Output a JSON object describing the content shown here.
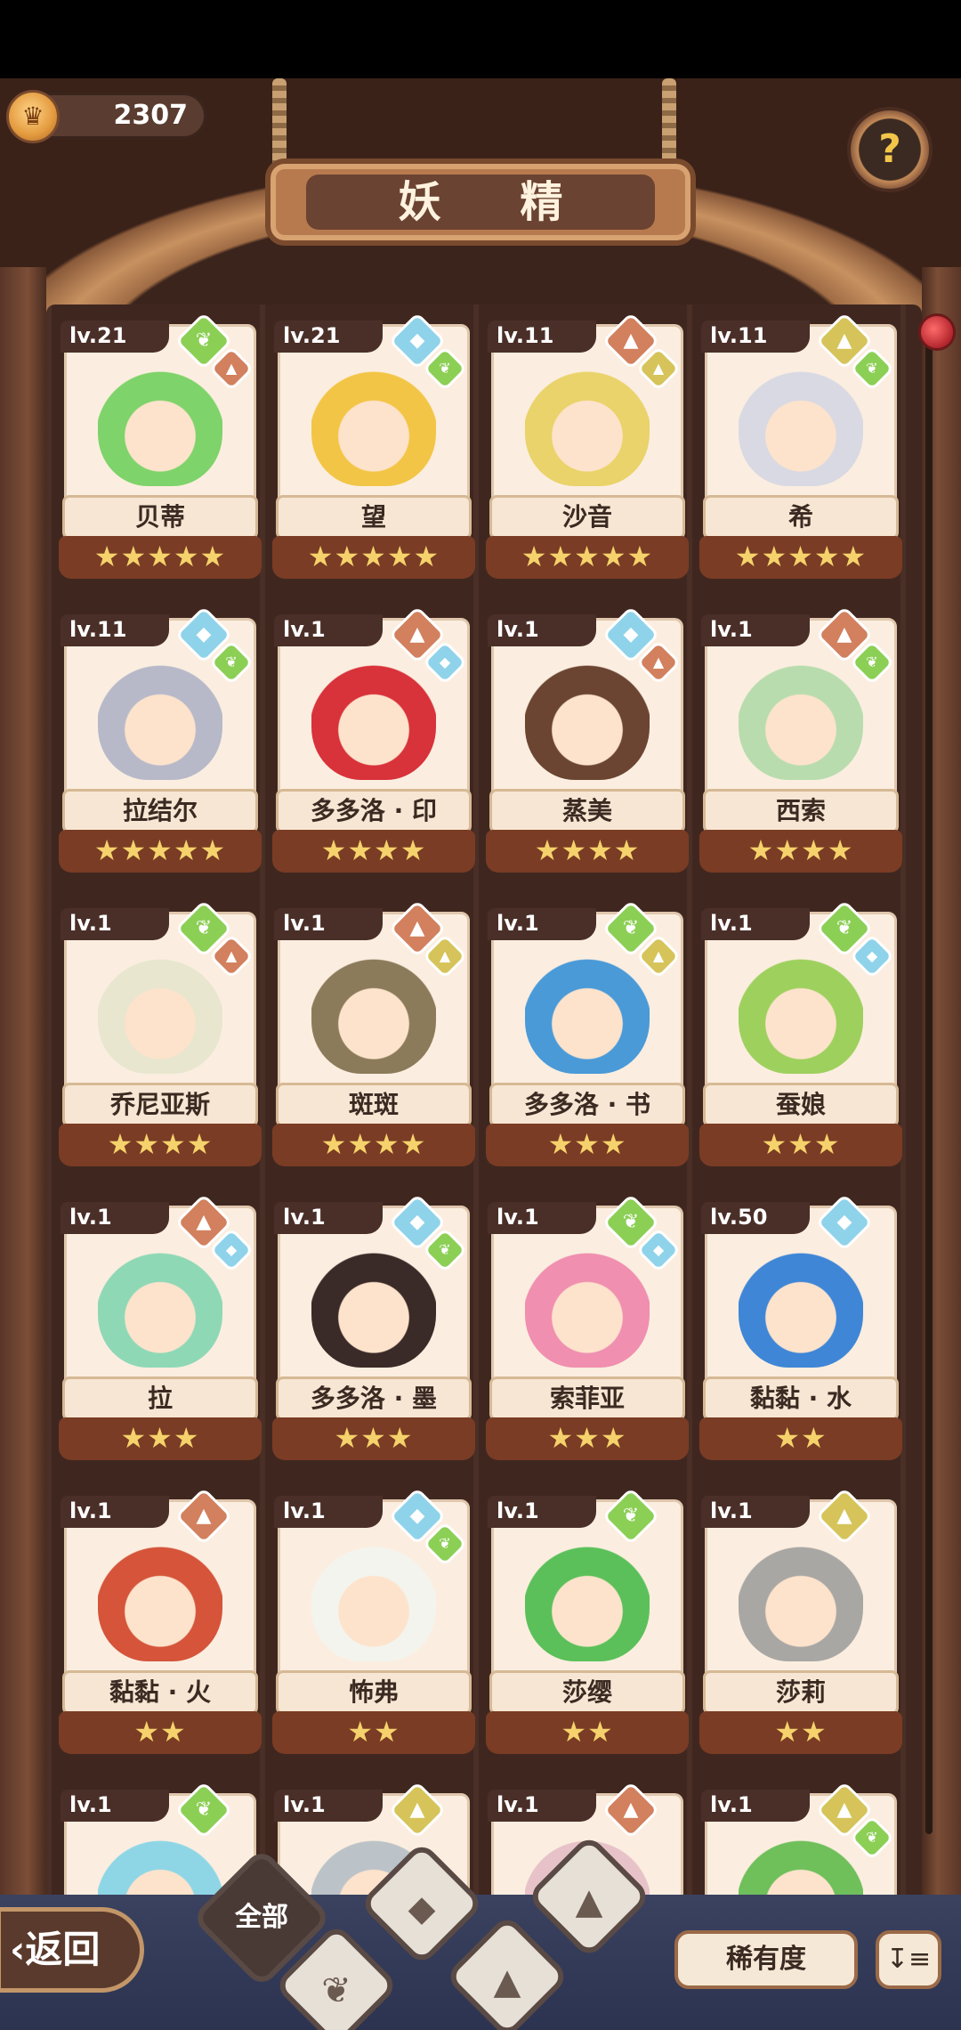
{
  "header": {
    "title": "妖 精",
    "coins": "2307",
    "help_label": "?"
  },
  "footer": {
    "back_label": "返回",
    "filter_all_label": "全部",
    "sort_label": "稀有度",
    "order_label": "↧≡"
  },
  "colors": {
    "grass": "#8ccf55",
    "water": "#8fd3ea",
    "fire": "#d2805e",
    "earth": "#d6c45a"
  },
  "fairies": [
    {
      "level": "lv.21",
      "name": "贝蒂",
      "stars": "★★★★★",
      "elements": [
        "grass",
        "fire"
      ],
      "hair": "#7ed36a"
    },
    {
      "level": "lv.21",
      "name": "望",
      "stars": "★★★★★",
      "elements": [
        "water",
        "grass"
      ],
      "hair": "#f3c546"
    },
    {
      "level": "lv.11",
      "name": "沙音",
      "stars": "★★★★★",
      "elements": [
        "fire",
        "earth"
      ],
      "hair": "#e9d36a"
    },
    {
      "level": "lv.11",
      "name": "希",
      "stars": "★★★★★",
      "elements": [
        "earth",
        "grass"
      ],
      "hair": "#d9d9e3"
    },
    {
      "level": "lv.11",
      "name": "拉结尔",
      "stars": "★★★★★",
      "elements": [
        "water",
        "grass"
      ],
      "hair": "#b7b9c9"
    },
    {
      "level": "lv.1",
      "name": "多多洛 · 印",
      "stars": "★★★★",
      "elements": [
        "fire",
        "water"
      ],
      "hair": "#d8323a"
    },
    {
      "level": "lv.1",
      "name": "蒸美",
      "stars": "★★★★",
      "elements": [
        "water",
        "fire"
      ],
      "hair": "#6b4532"
    },
    {
      "level": "lv.1",
      "name": "西索",
      "stars": "★★★★",
      "elements": [
        "fire",
        "grass"
      ],
      "hair": "#b9dcae"
    },
    {
      "level": "lv.1",
      "name": "乔尼亚斯",
      "stars": "★★★★",
      "elements": [
        "grass",
        "fire"
      ],
      "hair": "#e8e6cf"
    },
    {
      "level": "lv.1",
      "name": "斑斑",
      "stars": "★★★★",
      "elements": [
        "fire",
        "earth"
      ],
      "hair": "#8c7b5a"
    },
    {
      "level": "lv.1",
      "name": "多多洛 · 书",
      "stars": "★★★",
      "elements": [
        "grass",
        "earth"
      ],
      "hair": "#4a9ad8"
    },
    {
      "level": "lv.1",
      "name": "蚕娘",
      "stars": "★★★",
      "elements": [
        "grass",
        "water"
      ],
      "hair": "#9ed05e"
    },
    {
      "level": "lv.1",
      "name": "拉",
      "stars": "★★★",
      "elements": [
        "fire",
        "water"
      ],
      "hair": "#8fd8b6"
    },
    {
      "level": "lv.1",
      "name": "多多洛 · 墨",
      "stars": "★★★",
      "elements": [
        "water",
        "grass"
      ],
      "hair": "#3a2b28"
    },
    {
      "level": "lv.1",
      "name": "索菲亚",
      "stars": "★★★",
      "elements": [
        "grass",
        "water"
      ],
      "hair": "#f08fb0"
    },
    {
      "level": "lv.50",
      "name": "黏黏 · 水",
      "stars": "★★",
      "elements": [
        "water"
      ],
      "hair": "#3f86d6"
    },
    {
      "level": "lv.1",
      "name": "黏黏 · 火",
      "stars": "★★",
      "elements": [
        "fire"
      ],
      "hair": "#d5543a"
    },
    {
      "level": "lv.1",
      "name": "怖弗",
      "stars": "★★",
      "elements": [
        "water",
        "grass"
      ],
      "hair": "#f4f4ee"
    },
    {
      "level": "lv.1",
      "name": "莎缨",
      "stars": "★★",
      "elements": [
        "grass"
      ],
      "hair": "#5bc05a"
    },
    {
      "level": "lv.1",
      "name": "莎莉",
      "stars": "★★",
      "elements": [
        "earth"
      ],
      "hair": "#a9a7a4"
    },
    {
      "level": "lv.1",
      "name": "",
      "stars": "",
      "elements": [
        "grass"
      ],
      "hair": "#8ed6e6"
    },
    {
      "level": "lv.1",
      "name": "",
      "stars": "",
      "elements": [
        "earth"
      ],
      "hair": "#bcc3c8"
    },
    {
      "level": "lv.1",
      "name": "",
      "stars": "",
      "elements": [
        "fire"
      ],
      "hair": "#e7c2c8"
    },
    {
      "level": "lv.1",
      "name": "",
      "stars": "",
      "elements": [
        "earth",
        "grass"
      ],
      "hair": "#6fbf5b"
    }
  ]
}
